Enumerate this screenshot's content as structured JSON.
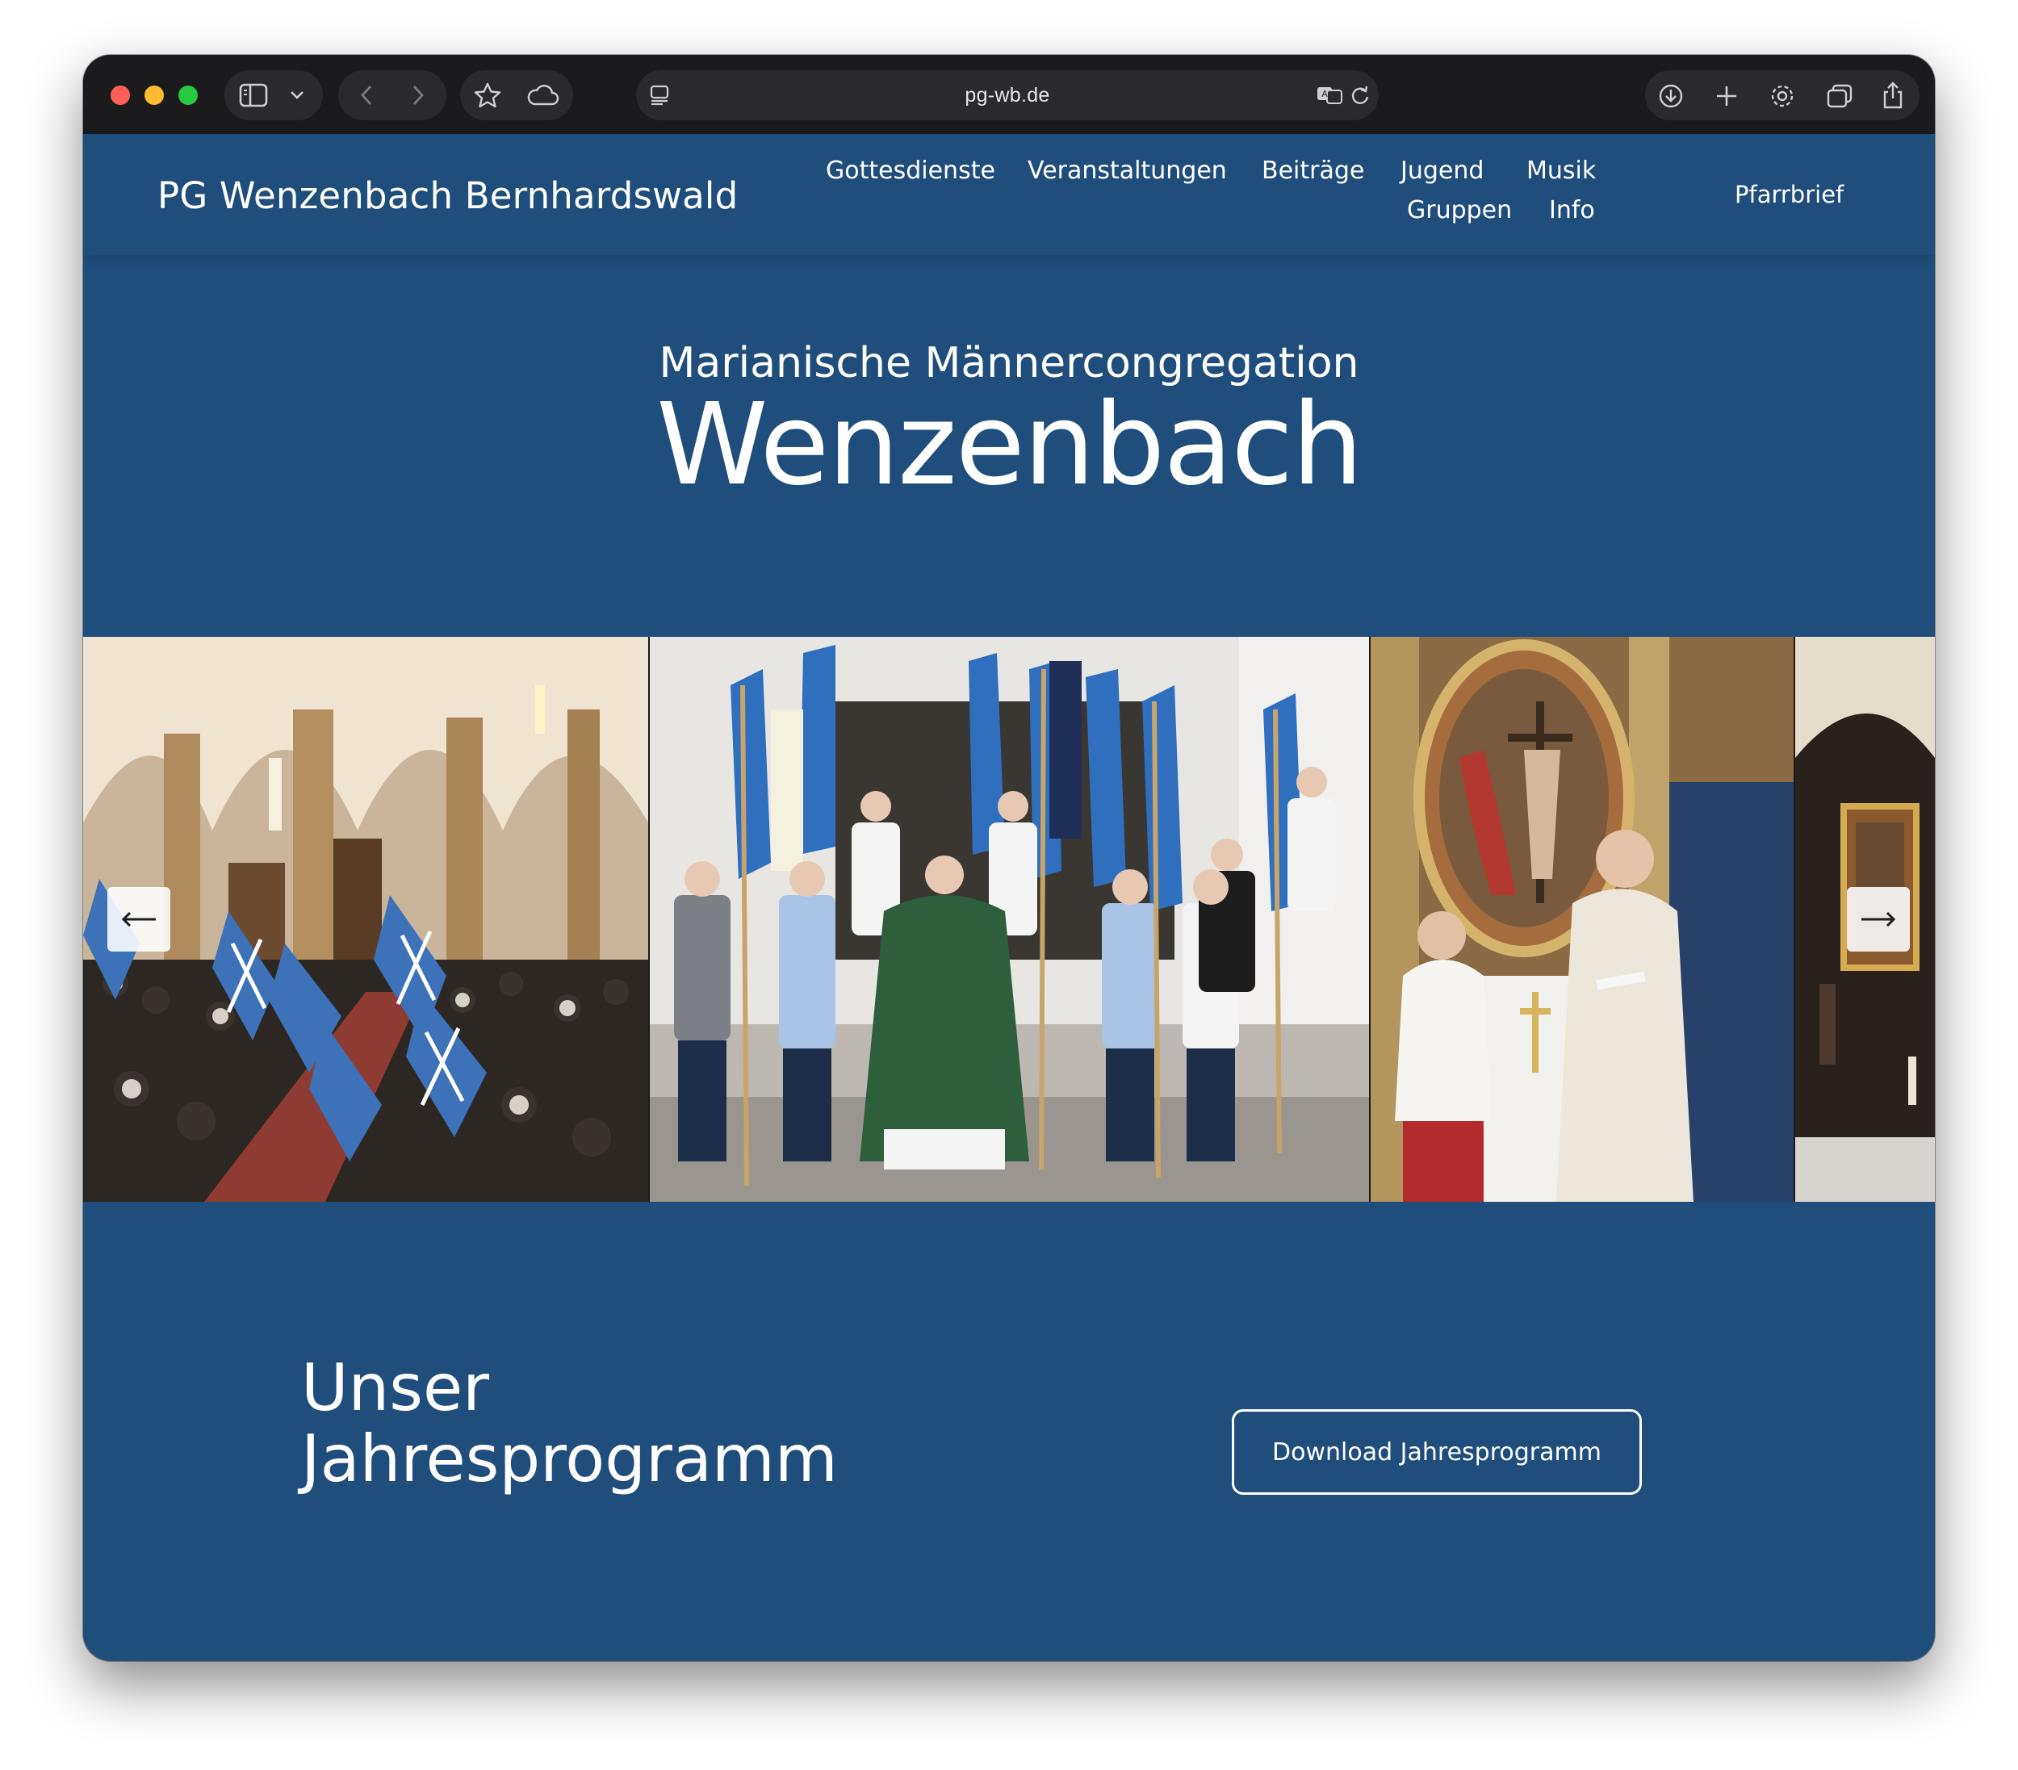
{
  "browser": {
    "url": "pg-wb.de",
    "icons": [
      "sidebar-icon",
      "chevron-down-icon",
      "back-icon",
      "forward-icon",
      "star-icon",
      "cloud-icon",
      "page-menu-icon",
      "translate-icon",
      "reload-icon",
      "download-icon",
      "plus-icon",
      "gear-icon",
      "tabs-icon",
      "share-icon"
    ]
  },
  "site": {
    "brand": "PG Wenzenbach Bernhardswald",
    "nav": [
      {
        "label": "Gottesdienste"
      },
      {
        "label": "Veranstaltungen"
      },
      {
        "label": "Beiträge"
      },
      {
        "label": "Jugend"
      },
      {
        "label": "Musik"
      },
      {
        "label": "Gruppen"
      },
      {
        "label": "Info"
      }
    ],
    "cta": "Pfarrbrief",
    "colors": {
      "background": "#1f4e7c",
      "text": "#ffffff"
    }
  },
  "hero": {
    "subtitle": "Marianische Männercongregation",
    "title": "Wenzenbach"
  },
  "gallery": {
    "prev_arrow": "←",
    "next_arrow": "→"
  },
  "program": {
    "title_line1": "Unser",
    "title_line2": "Jahresprogramm",
    "button": "Download Jahresprogramm"
  }
}
